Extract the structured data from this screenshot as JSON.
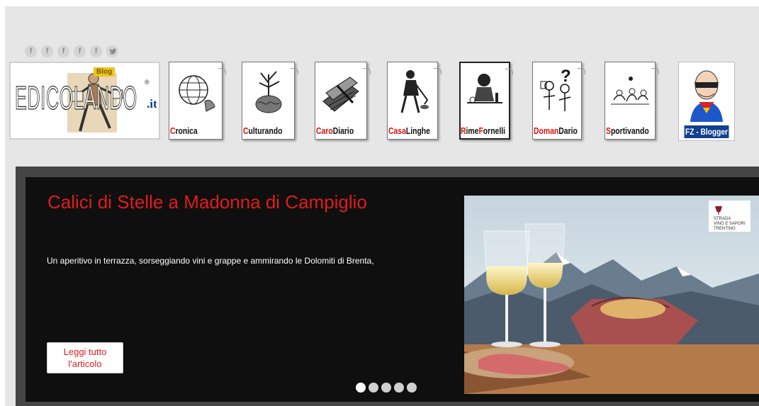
{
  "social": {
    "icons": [
      {
        "name": "facebook-icon",
        "glyph": "f"
      },
      {
        "name": "facebook-icon",
        "glyph": "f"
      },
      {
        "name": "facebook-icon",
        "glyph": "f"
      },
      {
        "name": "facebook-icon",
        "glyph": "f"
      },
      {
        "name": "facebook-icon",
        "glyph": "f"
      },
      {
        "name": "twitter-icon",
        "glyph": "🐦"
      }
    ]
  },
  "logo": {
    "text": "EDICOLANDO",
    "suffix": ".it",
    "badge": "Blog",
    "reg": "®"
  },
  "categories": [
    {
      "first": "C",
      "rest": "ronica"
    },
    {
      "first": "C",
      "rest": "ulturando"
    },
    {
      "first": "Caro",
      "rest": "Diario"
    },
    {
      "first": "Casa",
      "rest": "Linghe"
    },
    {
      "first": "R",
      "rest": "ime",
      "first2": "F",
      "rest2": "ornelli"
    },
    {
      "first": "Doman",
      "rest": "Dario"
    },
    {
      "first": "S",
      "rest": "portivando"
    }
  ],
  "fz_label": "FZ - Blogger",
  "slider": {
    "title": "Calici di Stelle a Madonna di Campiglio",
    "excerpt": "Un aperitivo in terrazza, sorseggiando vini e grappe e ammirando le Dolomiti di Brenta,",
    "read_more": "Leggi tutto l'articolo",
    "dots_total": 5,
    "active_dot": 1,
    "image_logo": {
      "line1": "Strada",
      "line2": "Vino e Sapori",
      "line3": "Trentino"
    }
  },
  "colors": {
    "accent_red": "#e21b1b",
    "slider_bg": "#0f0f0f",
    "page_bg": "#e6e6e6"
  }
}
